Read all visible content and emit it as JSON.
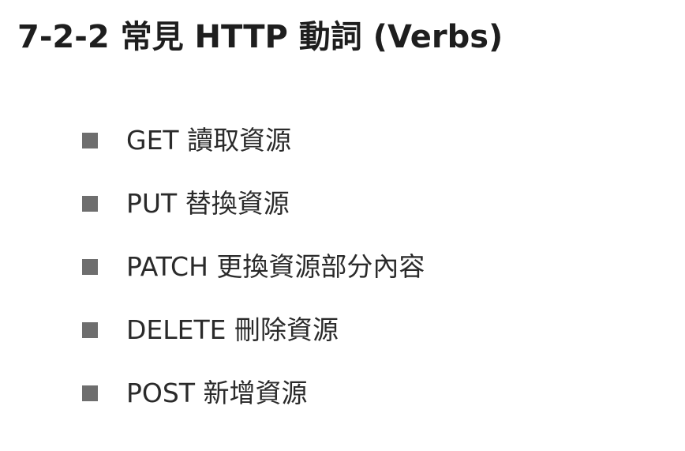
{
  "slide": {
    "title": "7-2-2  常見 HTTP 動詞 (Verbs)",
    "bullets": [
      {
        "text": "GET 讀取資源"
      },
      {
        "text": "PUT 替換資源"
      },
      {
        "text": "PATCH 更換資源部分內容"
      },
      {
        "text": "DELETE 刪除資源"
      },
      {
        "text": "POST 新增資源"
      }
    ],
    "colors": {
      "title": "#1e1e1e",
      "text": "#2a2a2a",
      "bullet_marker": "#6e6e6e",
      "background": "#ffffff"
    }
  }
}
